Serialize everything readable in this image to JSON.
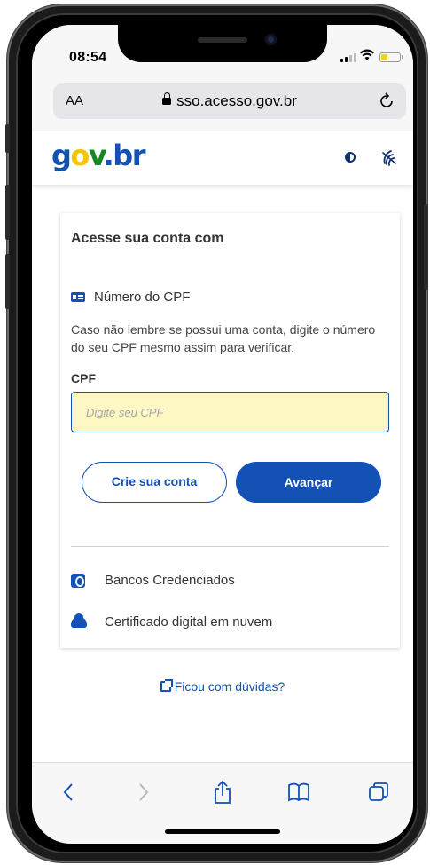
{
  "status_bar": {
    "time": "08:54",
    "battery_level": 0.35,
    "battery_color": "#f2d21b"
  },
  "browser": {
    "text_size_label": "AA",
    "url": "sso.acesso.gov.br",
    "reload_icon": "reload-icon",
    "lock_icon": "lock-icon"
  },
  "header": {
    "logo_parts": [
      "g",
      "o",
      "v",
      ".",
      "br"
    ],
    "contrast_icon": "contrast-icon",
    "vlibras_icon": "vlibras-icon"
  },
  "login": {
    "title": "Acesse sua conta com",
    "method_label": "Número do CPF",
    "hint": "Caso não lembre se possui uma conta, digite o número do seu CPF mesmo assim para verificar.",
    "field_label": "CPF",
    "input_value": "",
    "input_placeholder": "Digite seu CPF",
    "create_account_label": "Crie sua conta",
    "next_label": "Avançar"
  },
  "alternatives": [
    {
      "label": "Bancos Credenciados",
      "icon": "bank-icon"
    },
    {
      "label": "Certificado digital em nuvem",
      "icon": "cloud-icon"
    }
  ],
  "help_link": "Ficou com dúvidas?",
  "toolbar": {
    "icons": [
      "back-icon",
      "forward-icon",
      "share-icon",
      "bookmarks-icon",
      "tabs-icon"
    ]
  },
  "colors": {
    "primary": "#1351b4",
    "input_bg": "#fdf7c3",
    "logo_yellow": "#f5c500",
    "logo_green": "#168821"
  }
}
